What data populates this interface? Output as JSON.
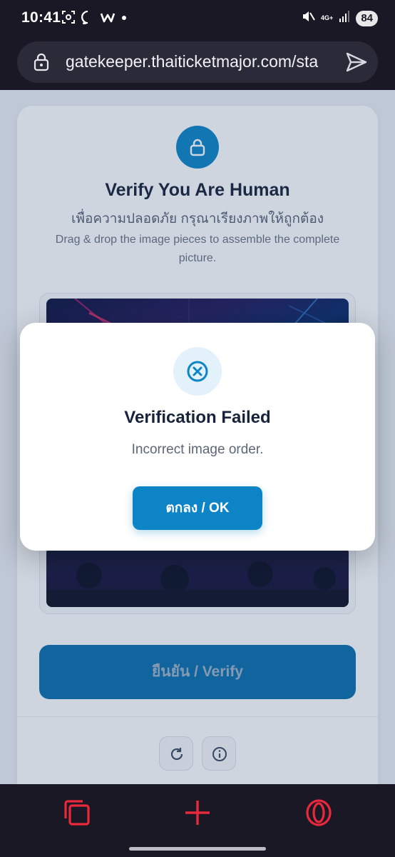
{
  "status_bar": {
    "time": "10:41",
    "network": "4G+",
    "battery": "84"
  },
  "address_bar": {
    "url": "gatekeeper.thaiticketmajor.com/sta"
  },
  "page": {
    "title": "Verify You Are Human",
    "subtitle_thai": "เพื่อความปลอดภัย กรุณาเรียงภาพให้ถูกต้อง",
    "subtitle_eng": "Drag & drop the image pieces to assemble the complete picture.",
    "verify_button": "ยืนยัน / Verify"
  },
  "modal": {
    "title": "Verification Failed",
    "message": "Incorrect image order.",
    "ok_button": "ตกลง / OK"
  },
  "colors": {
    "accent": "#0c84c6",
    "browser_red": "#e8293c"
  },
  "icons": [
    "lock-icon",
    "send-icon",
    "x-circle-icon",
    "refresh-icon",
    "info-icon",
    "tabs-icon",
    "plus-icon",
    "opera-icon"
  ]
}
